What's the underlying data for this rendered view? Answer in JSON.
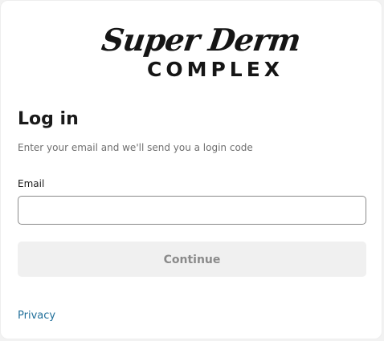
{
  "brand": {
    "logo_script": "Super Derm",
    "logo_block": "COMPLEX"
  },
  "login": {
    "title": "Log in",
    "subtitle": "Enter your email and we'll send you a login code",
    "email_label": "Email",
    "email_value": "",
    "email_placeholder": "",
    "continue_label": "Continue",
    "continue_state": "disabled"
  },
  "footer": {
    "privacy_label": "Privacy"
  },
  "colors": {
    "page_background": "#f2f2f2",
    "card_background": "#ffffff",
    "button_disabled_background": "#f0f0f0",
    "button_disabled_text": "#8a8a8a",
    "link": "#1f6e99",
    "text_primary": "#1a1a1a",
    "text_secondary": "#6f6f6f"
  }
}
